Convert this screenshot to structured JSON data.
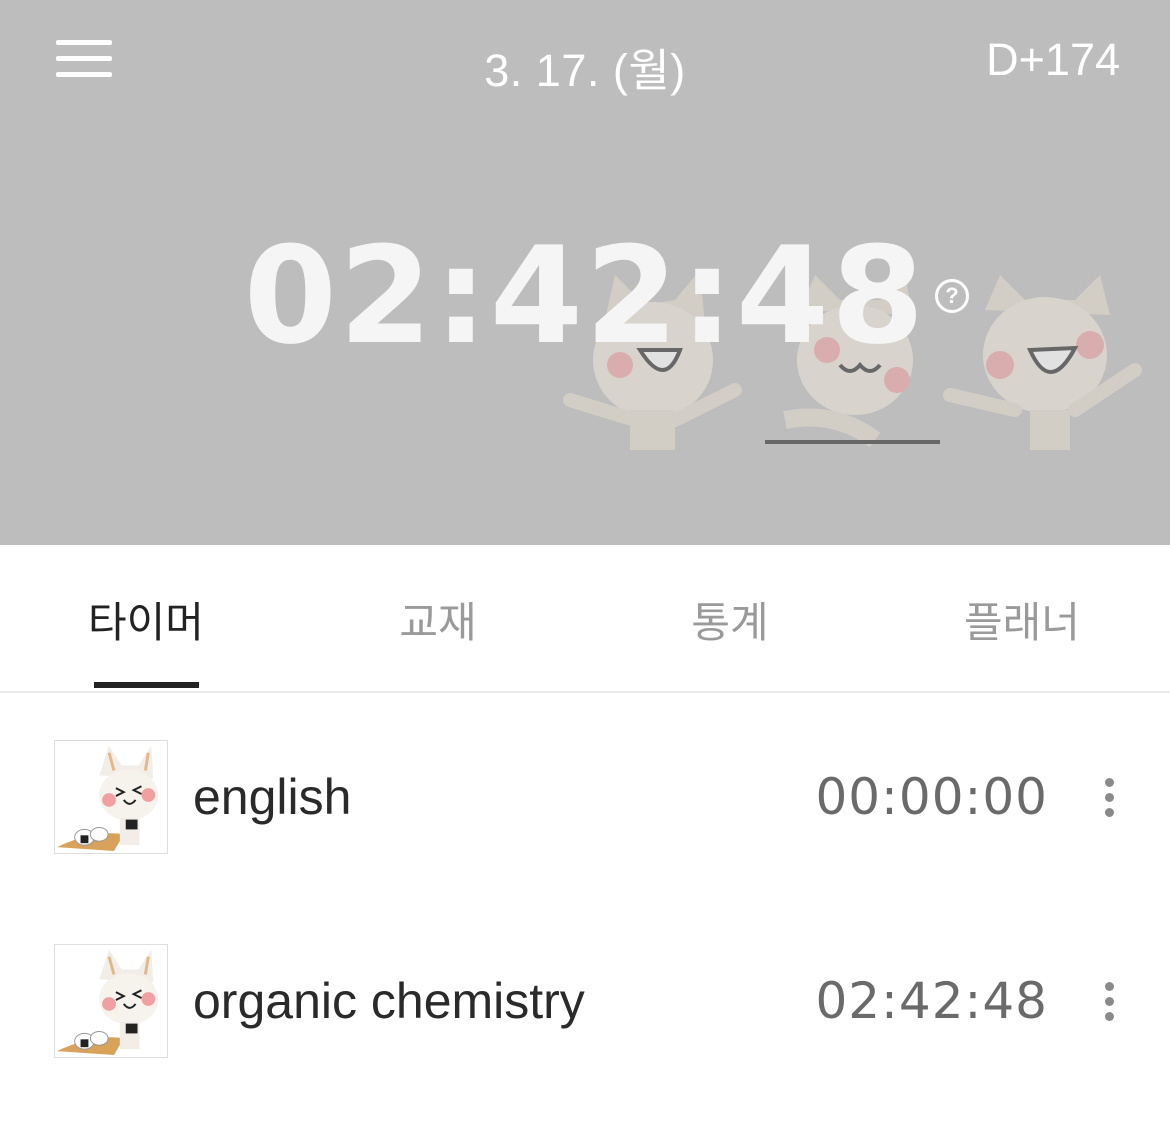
{
  "header": {
    "date": "3. 17. (월)",
    "dday": "D+174",
    "total_time": "02:42:48",
    "help_glyph": "?",
    "background_color": "#bdbdbd"
  },
  "tabs": [
    {
      "label": "타이머",
      "active": true
    },
    {
      "label": "교재",
      "active": false
    },
    {
      "label": "통계",
      "active": false
    },
    {
      "label": "플래너",
      "active": false
    }
  ],
  "subjects": [
    {
      "name": "english",
      "time": "00:00:00",
      "icon": "cat-onigiri-icon"
    },
    {
      "name": "organic chemistry",
      "time": "02:42:48",
      "icon": "cat-onigiri-icon"
    }
  ]
}
